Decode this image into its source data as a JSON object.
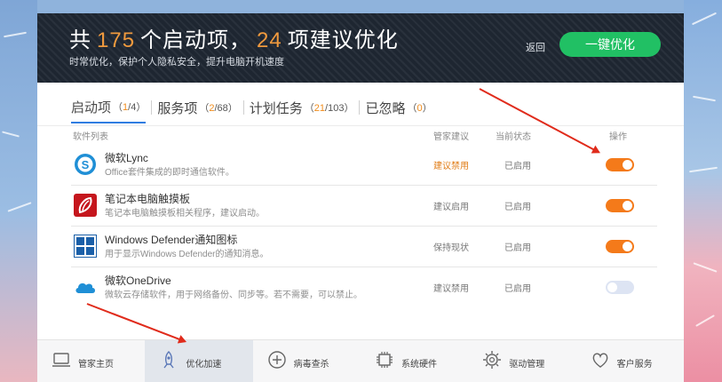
{
  "header": {
    "title_prefix": "共",
    "total_count": "175",
    "title_mid": "个启动项，",
    "suggest_count": "24",
    "title_suffix": "项建议优化",
    "subtitle": "时常优化，保护个人隐私安全，提升电脑开机速度",
    "back_label": "返回",
    "optimize_label": "一键优化"
  },
  "tabs": [
    {
      "label": "启动项",
      "count_open": "（",
      "count_hl": "1",
      "count_rest": "/4）"
    },
    {
      "label": "服务项",
      "count_open": "（",
      "count_hl": "2",
      "count_rest": "/68）"
    },
    {
      "label": "计划任务",
      "count_open": "（",
      "count_hl": "21",
      "count_rest": "/103）"
    },
    {
      "label": "已忽略",
      "count_open": "（",
      "count_hl": "0",
      "count_rest": "）"
    }
  ],
  "columns": {
    "software": "软件列表",
    "advice": "管家建议",
    "status": "当前状态",
    "action": "操作"
  },
  "rows": [
    {
      "name": "微软Lync",
      "desc": "Office套件集成的即时通信软件。",
      "advice": "建议禁用",
      "status": "已启用",
      "icon": "lync-icon",
      "toggle_on": true
    },
    {
      "name": "笔记本电脑触摸板",
      "desc": "笔记本电脑触摸板相关程序，建议启动。",
      "advice": "建议启用",
      "status": "已启用",
      "icon": "touchpad-icon",
      "toggle_on": true
    },
    {
      "name": "Windows Defender通知图标",
      "desc": "用于显示Windows Defender的通知消息。",
      "advice": "保持现状",
      "status": "已启用",
      "icon": "windows-defender-icon",
      "toggle_on": true
    },
    {
      "name": "微软OneDrive",
      "desc": "微软云存储软件，用于网络备份、同步等。若不需要，可以禁止。",
      "advice": "建议禁用",
      "status": "已启用",
      "icon": "onedrive-icon",
      "toggle_on": false
    }
  ],
  "nav": [
    {
      "label": "管家主页",
      "icon": "laptop-icon"
    },
    {
      "label": "优化加速",
      "icon": "rocket-icon"
    },
    {
      "label": "病毒查杀",
      "icon": "shield-plus-icon"
    },
    {
      "label": "系统硬件",
      "icon": "chip-icon"
    },
    {
      "label": "驱动管理",
      "icon": "gear-icon"
    },
    {
      "label": "客户服务",
      "icon": "heart-icon"
    }
  ],
  "colors": {
    "accent_orange": "#f09a3e",
    "button_green": "#21c064",
    "tab_blue": "#2f7de1",
    "annotation_red": "#e02b1b"
  }
}
